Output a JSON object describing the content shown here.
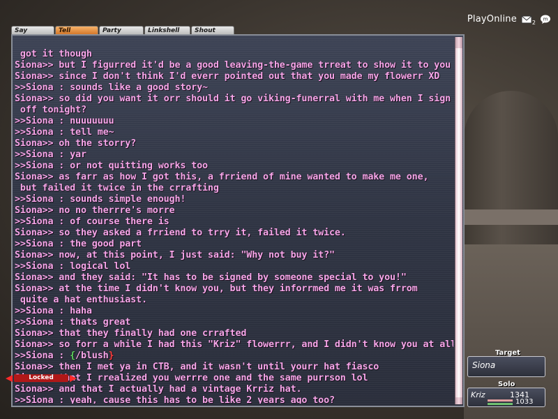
{
  "playonline": {
    "label": "PlayOnline",
    "mail_count": "2",
    "icons": [
      "mail-icon",
      "chat-bubble-icon"
    ]
  },
  "tabs": [
    {
      "label": "Say",
      "active": false
    },
    {
      "label": "Tell",
      "active": true
    },
    {
      "label": "Party",
      "active": false
    },
    {
      "label": "Linkshell",
      "active": false
    },
    {
      "label": "Shout",
      "active": false
    }
  ],
  "chat_lines": [
    " got it though",
    "Siona>> but I figurred it'd be a good leaving-the-game trreat to show it to you",
    "Siona>> since I don't think I'd everr pointed out that you made my flowerr XD",
    ">>Siona : sounds like a good story~",
    "Siona>> so did you want it orr should it go viking-funerral with me when I sign",
    " off tonight?",
    ">>Siona : nuuuuuuu",
    ">>Siona : tell me~",
    "Siona>> oh the storry?",
    ">>Siona : yar",
    ">>Siona : or not quitting works too",
    "Siona>> as farr as how I got this, a frriend of mine wanted to make me one,",
    " but failed it twice in the crrafting",
    ">>Siona : sounds simple enough!",
    "Siona>> no no therrre's morre",
    ">>Siona : of course there is",
    "Siona>> so they asked a frriend to trry it, failed it twice.",
    ">>Siona : the good part",
    "Siona>> now, at this point, I just said: \"Why not buy it?\"",
    ">>Siona : logical lol",
    "Siona>> and they said: \"It has to be signed by someone special to you!\"",
    "Siona>> at the time I didn't know you, but they inforrmed me it was frrom",
    " quite a hat enthusiast.",
    ">>Siona : haha",
    ">>Siona : thats great",
    "Siona>> that they finally had one crrafted",
    "Siona>> so forr a while I had this \"Kriz\" flowerrr, and I didn't know you at all",
    ">>Siona : /blush",
    "Siona>> then I met ya in CTB, and it wasn't until yourr hat fiasco",
    "Siona>> that I rrealized you werrre one and the same purrson lol",
    "Siona>> and that I actually had a vintage Krriz hat.",
    ">>Siona : yeah, cause this has to be like 2 years ago too?"
  ],
  "emote": {
    "prefix": ">>Siona : ",
    "left": "{",
    "text": "/blush",
    "right": "}"
  },
  "target": {
    "label": "Target",
    "name": "Siona",
    "status": "Locked"
  },
  "party": {
    "label": "Solo",
    "name": "Kriz",
    "hp": "1341",
    "mp": "1033"
  },
  "colors": {
    "tell_text": "#f7a6ea",
    "tab_active": "#e08b3a",
    "locked": "#b01818"
  }
}
